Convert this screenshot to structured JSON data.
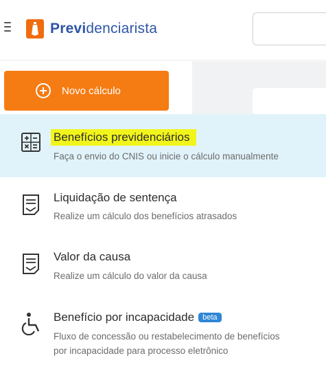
{
  "header": {
    "brand_bold": "Previ",
    "brand_rest": "denciarista"
  },
  "new_calc": {
    "label": "Novo cálculo"
  },
  "menu": {
    "items": [
      {
        "title": "Benefícios previdenciários",
        "description": "Faça o envio do CNIS ou inicie o cálculo manualmente",
        "icon": "calculator-icon"
      },
      {
        "title": "Liquidação de sentença",
        "description": "Realize um cálculo dos benefícios atrasados",
        "icon": "document-icon"
      },
      {
        "title": "Valor da causa",
        "description": "Realize um cálculo do valor da causa",
        "icon": "document-icon"
      },
      {
        "title": "Benefício por incapacidade",
        "badge": "beta",
        "description_line1": "Fluxo de concessão ou restabelecimento de benefícios",
        "description_line2": "por incapacidade para processo eletrônico",
        "icon": "wheelchair-icon"
      }
    ]
  },
  "colors": {
    "accent_orange": "#f57c13",
    "brand_blue": "#2f56a6",
    "active_row": "#e1f3fa",
    "highlight_yellow": "#f2f51b",
    "beta_badge": "#2f86d6"
  }
}
